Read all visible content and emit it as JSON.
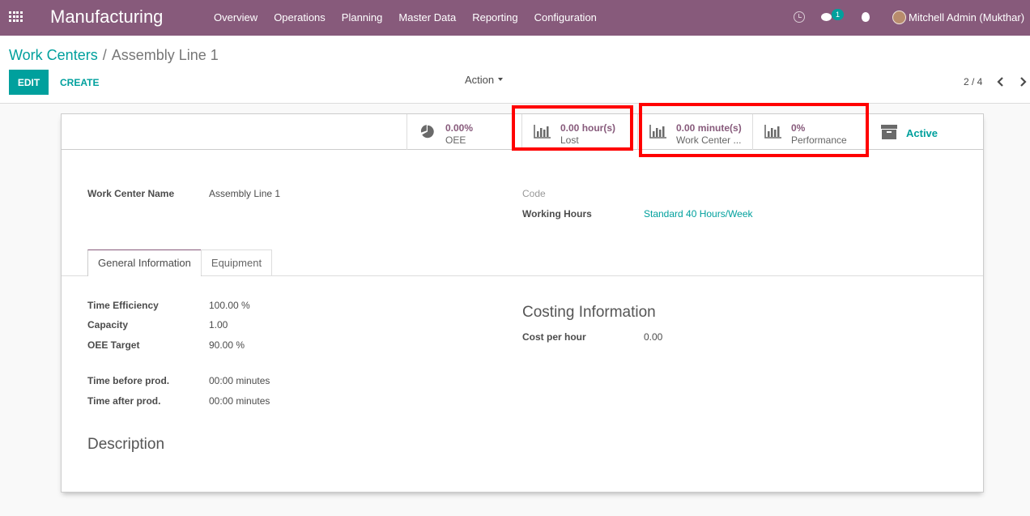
{
  "navbar": {
    "brand": "Manufacturing",
    "menu": [
      "Overview",
      "Operations",
      "Planning",
      "Master Data",
      "Reporting",
      "Configuration"
    ],
    "chat_count": "1",
    "user": "Mitchell Admin (Mukthar)"
  },
  "breadcrumb": {
    "parent": "Work Centers",
    "separator": "/",
    "current": "Assembly Line 1"
  },
  "buttons": {
    "edit": "EDIT",
    "create": "CREATE",
    "action": "Action"
  },
  "pager": {
    "text": "2 / 4"
  },
  "stat_buttons": {
    "oee": {
      "value": "0.00%",
      "label": "OEE",
      "icon": "pie-chart-icon"
    },
    "lost": {
      "value": "0.00 hour(s)",
      "label": "Lost",
      "icon": "bar-chart-icon"
    },
    "load": {
      "value": "0.00 minute(s)",
      "label": "Work Center ...",
      "icon": "bar-chart-icon"
    },
    "performance": {
      "value": "0%",
      "label": "Performance",
      "icon": "bar-chart-icon"
    },
    "active": {
      "value": "Active",
      "icon": "archive-icon"
    }
  },
  "form": {
    "name_label": "Work Center Name",
    "name_value": "Assembly Line 1",
    "code_label": "Code",
    "code_value": "",
    "working_hours_label": "Working Hours",
    "working_hours_value": "Standard 40 Hours/Week"
  },
  "tabs": [
    "General Information",
    "Equipment"
  ],
  "general": {
    "time_efficiency_label": "Time Efficiency",
    "time_efficiency_value": "100.00",
    "time_efficiency_unit": "%",
    "capacity_label": "Capacity",
    "capacity_value": "1.00",
    "oee_target_label": "OEE Target",
    "oee_target_value": "90.00",
    "oee_target_unit": "%",
    "time_before_label": "Time before prod.",
    "time_before_value": "00:00 minutes",
    "time_after_label": "Time after prod.",
    "time_after_value": "00:00 minutes"
  },
  "costing": {
    "title": "Costing Information",
    "cost_label": "Cost per hour",
    "cost_value": "0.00"
  },
  "description": {
    "title": "Description"
  },
  "colors": {
    "navbar": "#875a7b",
    "accent": "#00a09d",
    "highlight": "#ff0000"
  }
}
